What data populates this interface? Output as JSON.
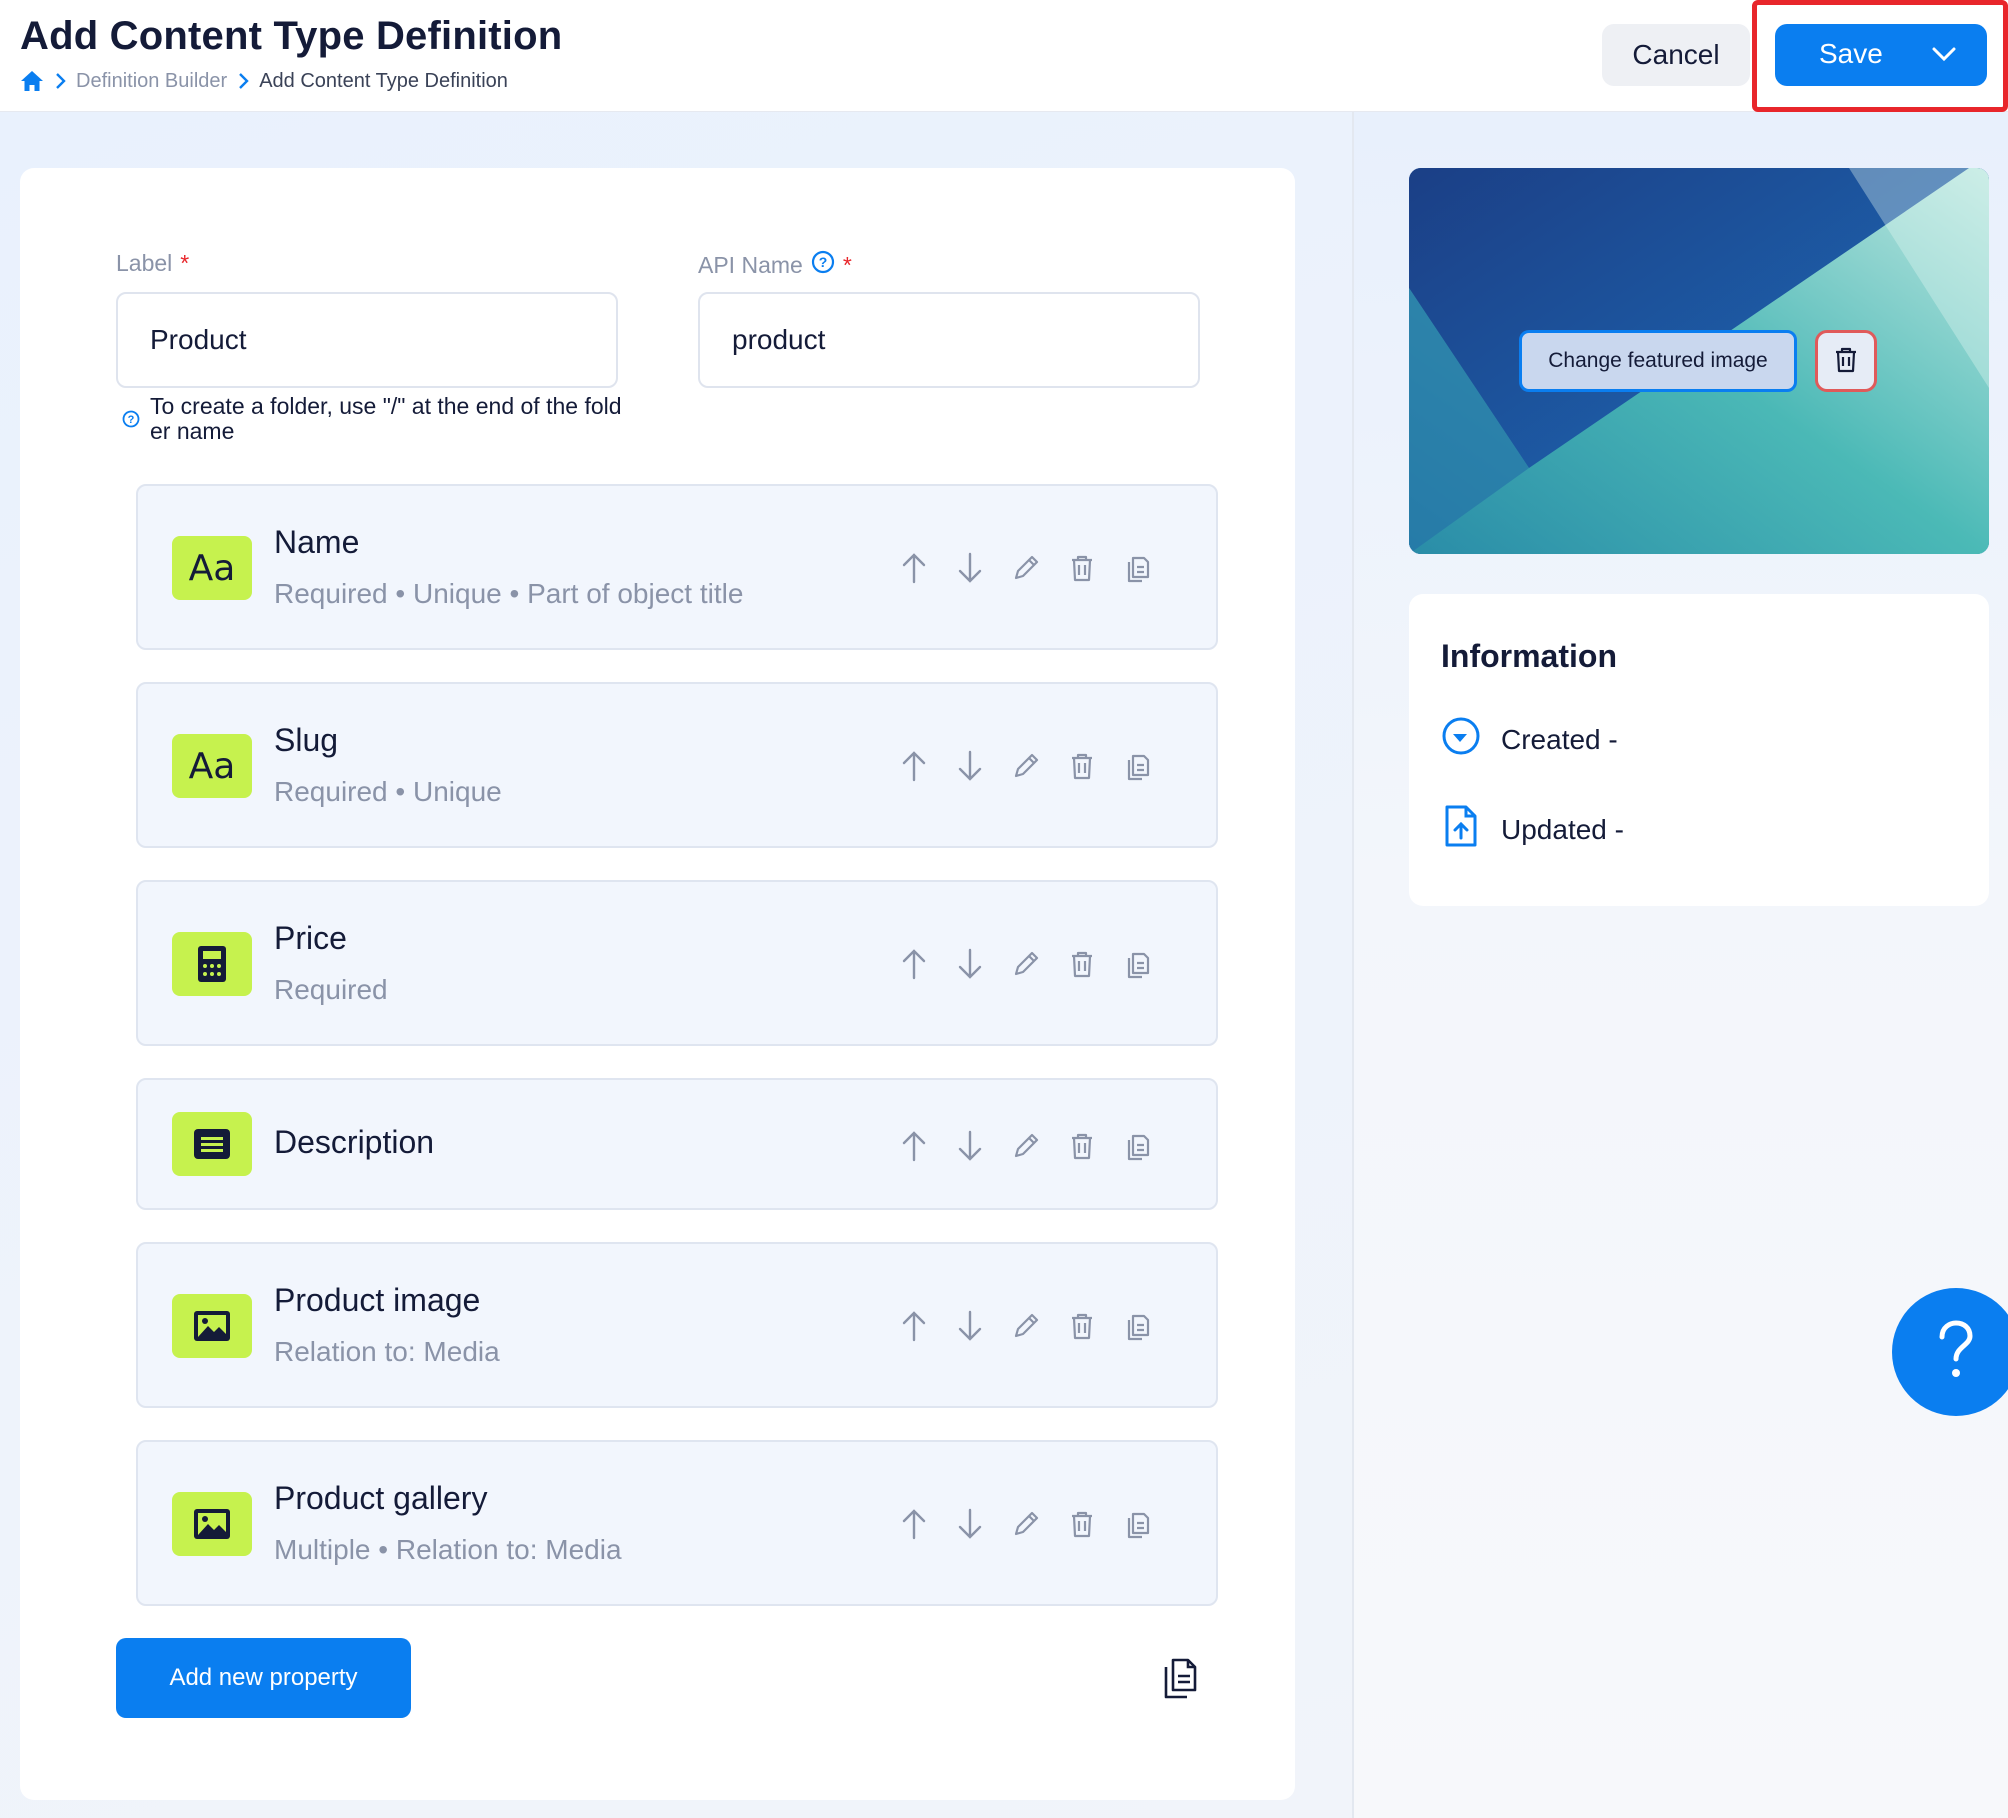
{
  "header": {
    "title": "Add Content Type Definition",
    "breadcrumb": [
      "Definition Builder",
      "Add Content Type Definition"
    ],
    "cancel_label": "Cancel",
    "save_label": "Save"
  },
  "form": {
    "label_field": {
      "label": "Label",
      "required_mark": "*",
      "value": "Product"
    },
    "api_field": {
      "label": "API Name",
      "required_mark": "*",
      "value": "product"
    },
    "hint": "To create a folder, use \"/\" at the end of the folder name"
  },
  "properties": [
    {
      "name": "Name",
      "meta": "Required • Unique • Part of object title",
      "icon": "text-type-icon"
    },
    {
      "name": "Slug",
      "meta": "Required • Unique",
      "icon": "text-type-icon"
    },
    {
      "name": "Price",
      "meta": "Required",
      "icon": "calculator-icon"
    },
    {
      "name": "Description",
      "meta": "",
      "icon": "rich-text-icon"
    },
    {
      "name": "Product image",
      "meta": "Relation to: Media",
      "icon": "image-icon"
    },
    {
      "name": "Product gallery",
      "meta": "Multiple • Relation to: Media",
      "icon": "image-icon"
    }
  ],
  "type_glyph": "Aa",
  "add_property_label": "Add new property",
  "featured_image": {
    "change_label": "Change featured image"
  },
  "information": {
    "title": "Information",
    "created": "Created -",
    "updated": "Updated -"
  },
  "colors": {
    "accent": "#0a7ef0",
    "icon_bg": "#c6f24e",
    "highlight": "#e8262b"
  }
}
